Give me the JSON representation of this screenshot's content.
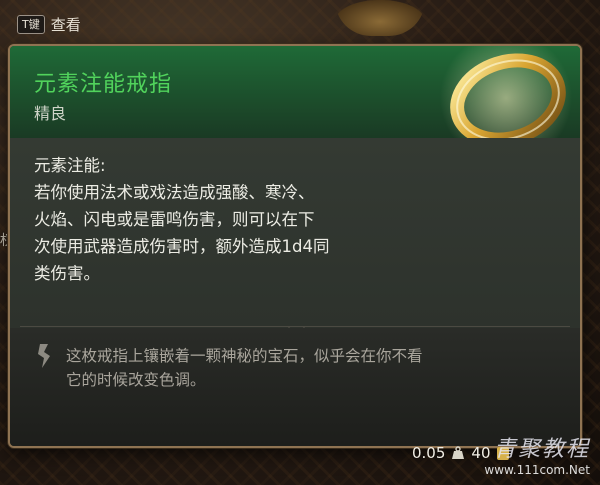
{
  "hint": {
    "key": "T键",
    "label": "查看"
  },
  "item": {
    "name": "元素注能戒指",
    "rarity": "精良",
    "accent": "#51d35c",
    "icon": "gold-ring-icon"
  },
  "description": {
    "lines": [
      "元素注能:",
      "若你使用法术或戏法造成强酸、寒冷、",
      "火焰、闪电或是雷鸣伤害，则可以在下",
      "次使用武器造成伤害时，额外造成1d4同",
      "类伤害。"
    ]
  },
  "lore": {
    "lines": [
      "这枚戒指上镶嵌着一颗神秘的宝石，似乎会在你不看",
      "它的时候改变色调。"
    ]
  },
  "stats": {
    "weight": "0.05",
    "value": "40"
  },
  "watermark": {
    "title": "青聚教程",
    "url": "www.111com.Net"
  },
  "side_glyph": "权"
}
